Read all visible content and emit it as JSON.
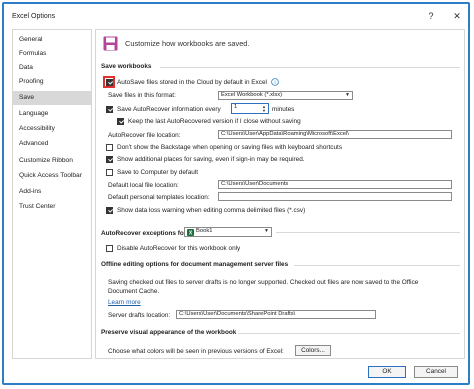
{
  "window": {
    "title": "Excel Options",
    "help_icon": "?",
    "close_icon": "✕"
  },
  "sidebar": {
    "items": [
      {
        "label": "General"
      },
      {
        "label": "Formulas"
      },
      {
        "label": "Data"
      },
      {
        "label": "Proofing"
      },
      {
        "label": "Save",
        "selected": true
      },
      {
        "label": "Language"
      },
      {
        "label": "Accessibility"
      },
      {
        "label": "Advanced"
      },
      {
        "label": "Customize Ribbon"
      },
      {
        "label": "Quick Access Toolbar"
      },
      {
        "label": "Add-ins"
      },
      {
        "label": "Trust Center"
      }
    ]
  },
  "main": {
    "heading": "Customize how workbooks are saved.",
    "save_workbooks": {
      "header": "Save workbooks",
      "autosave_cloud": {
        "label": "AutoSave files stored in the Cloud by default in Excel",
        "checked": true
      },
      "save_format_label": "Save files in this format:",
      "save_format_value": "Excel Workbook (*.xlsx)",
      "autorecover_every": {
        "label": "Save AutoRecover information every",
        "checked": true,
        "minutes_value": "1",
        "minutes_label": "minutes"
      },
      "keep_last": {
        "label": "Keep the last AutoRecovered version if I close without saving",
        "checked": true
      },
      "autorecover_location_label": "AutoRecover file location:",
      "autorecover_location_value": "C:\\Users\\User\\AppData\\Roaming\\Microsoft\\Excel\\",
      "dont_show_backstage": {
        "label": "Don't show the Backstage when opening or saving files with keyboard shortcuts",
        "checked": false
      },
      "show_additional_places": {
        "label": "Show additional places for saving, even if sign-in may be required.",
        "checked": true
      },
      "save_to_computer": {
        "label": "Save to Computer by default",
        "checked": false
      },
      "default_local_label": "Default local file location:",
      "default_local_value": "C:\\Users\\User\\Documents",
      "default_templates_label": "Default personal templates location:",
      "default_templates_value": "",
      "show_data_loss": {
        "label": "Show data loss warning when editing comma delimited files (*.csv)",
        "checked": true
      }
    },
    "autorecover_exceptions": {
      "header": "AutoRecover exceptions for:",
      "workbook_value": "Book1",
      "disable_autorecover": {
        "label": "Disable AutoRecover for this workbook only",
        "checked": false
      }
    },
    "offline": {
      "header": "Offline editing options for document management server files",
      "description_line1": "Saving checked out files to server drafts is no longer supported. Checked out files are now saved to the Office",
      "description_line2": "Document Cache.",
      "learn_more": "Learn more",
      "server_drafts_label": "Server drafts location:",
      "server_drafts_value": "C:\\Users\\User\\Documents\\SharePoint Drafts\\"
    },
    "visual": {
      "header": "Preserve visual appearance of the workbook",
      "colors_label": "Choose what colors will be seen in previous versions of Excel:",
      "colors_button": "Colors..."
    }
  },
  "footer": {
    "ok_label": "OK",
    "cancel_label": "Cancel"
  },
  "colors": {
    "accent": "#2e7ec7",
    "highlight": "#e03030",
    "excel_green": "#1d6f42",
    "save_icon": "#b4449a"
  }
}
